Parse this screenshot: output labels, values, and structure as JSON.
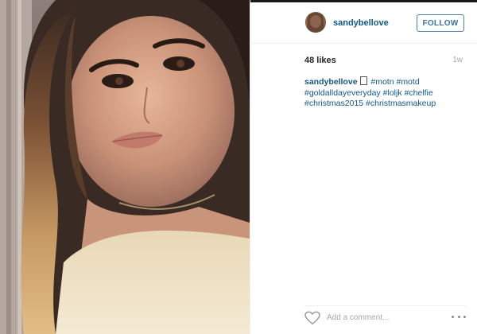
{
  "post": {
    "username": "sandybellove",
    "follow_label": "FOLLOW",
    "likes": "48 likes",
    "time_ago": "1w",
    "caption": {
      "username": "sandybellove",
      "tags_line1": "#motn #motd",
      "tags_line2": "#goldalldayeveryday #loljk #chelfie",
      "tags_line3": "#christmas2015 #christmasmakeup"
    },
    "comment_placeholder": "Add a comment...",
    "icons": {
      "like": "heart-icon",
      "more": "more-options-icon",
      "emoji": "emoji-icon"
    },
    "colors": {
      "link_blue": "#125688",
      "follow_border": "#4c7fb0",
      "muted_gray": "#a5a7aa"
    }
  }
}
